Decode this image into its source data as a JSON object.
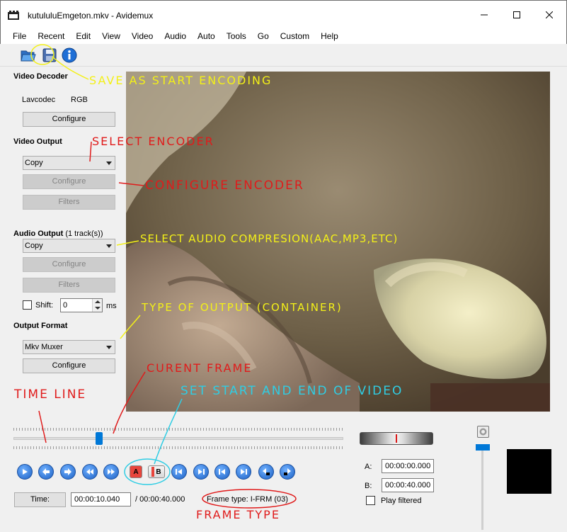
{
  "window": {
    "title": "kutululuEmgeton.mkv - Avidemux"
  },
  "menu": [
    "File",
    "Recent",
    "Edit",
    "View",
    "Video",
    "Audio",
    "Auto",
    "Tools",
    "Go",
    "Custom",
    "Help"
  ],
  "toolbar": {
    "icons": [
      "open-folder-icon",
      "save-icon",
      "info-icon"
    ]
  },
  "video_decoder": {
    "heading": "Video Decoder",
    "codec": "Lavcodec",
    "format": "RGB",
    "configure": "Configure"
  },
  "video_output": {
    "heading": "Video Output",
    "selected": "Copy",
    "configure": "Configure",
    "filters": "Filters"
  },
  "audio_output": {
    "heading": "Audio Output",
    "tracks": "(1 track(s))",
    "selected": "Copy",
    "configure": "Configure",
    "filters": "Filters",
    "shift_label": "Shift:",
    "shift_value": "0",
    "shift_unit": "ms"
  },
  "output_format": {
    "heading": "Output Format",
    "selected": "Mkv Muxer",
    "configure": "Configure"
  },
  "timeline": {
    "position_fraction": 0.26
  },
  "time": {
    "button": "Time:",
    "current": "00:00:10.040",
    "total": "/ 00:00:40.000",
    "frame_type": "Frame type:  I-FRM (03)"
  },
  "markers": {
    "a_label": "A:",
    "a_value": "00:00:00.000",
    "b_label": "B:",
    "b_value": "00:00:40.000",
    "play_filtered": "Play filtered"
  },
  "nav_buttons": {
    "marker_a": "A",
    "marker_b": "B"
  },
  "annotations": {
    "save_as": "SAVE AS START ENCODING",
    "select_encoder": "SELECT ENCODER",
    "configure_encoder": "CONFIGURE ENCODER",
    "select_audio": "SELECT AUDIO COMPRESION(AAC,MP3,ETC)",
    "type_output": "TYPE OF OUTPUT (CONTAINER)",
    "curent_frame": "CURENT FRAME",
    "set_start": "SET START AND END OF VIDEO",
    "time_line": "TIME LINE",
    "frame_type": "FRAME TYPE"
  },
  "colors": {
    "annotation_yellow": "#f3f018",
    "annotation_red": "#e01b1b",
    "annotation_cyan": "#2fcde4",
    "accent": "#0078d7"
  }
}
